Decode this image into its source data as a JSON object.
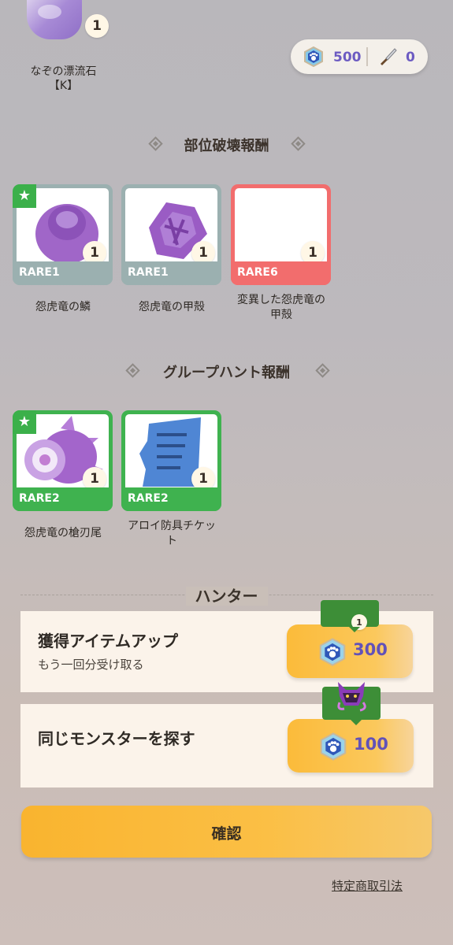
{
  "top_item": {
    "name": "なぞの漂流石\n【K】",
    "count": "1"
  },
  "currency": {
    "gems": "500",
    "knives": "0"
  },
  "part_break": {
    "title": "部位破壊報酬",
    "items": [
      {
        "name": "怨虎竜の鱗",
        "rarity": "RARE1",
        "count": "1"
      },
      {
        "name": "怨虎竜の甲殻",
        "rarity": "RARE1",
        "count": "1"
      },
      {
        "name": "変異した怨虎竜の\n甲殻",
        "rarity": "RARE6",
        "count": "1"
      }
    ]
  },
  "group_hunt": {
    "title": "グループハント報酬",
    "items": [
      {
        "name": "怨虎竜の槍刃尾",
        "rarity": "RARE2",
        "count": "1"
      },
      {
        "name": "アロイ防具チケッ\nト",
        "rarity": "RARE2",
        "count": "1"
      }
    ]
  },
  "hunter": {
    "title": "ハンター",
    "item_up": {
      "title": "獲得アイテムアップ",
      "subtitle": "もう一回分受け取る",
      "price": "300",
      "badge": "1"
    },
    "same_monster": {
      "title": "同じモンスターを探す",
      "price": "100"
    }
  },
  "confirm_label": "確認",
  "legal_link": "特定商取引法",
  "colors": {
    "accent_purple": "#6c5bc2",
    "button_yellow": "#fbbb3a",
    "rare1": "#9bb0b0",
    "rare2": "#3fb24f",
    "rare6": "#f26d6d"
  }
}
